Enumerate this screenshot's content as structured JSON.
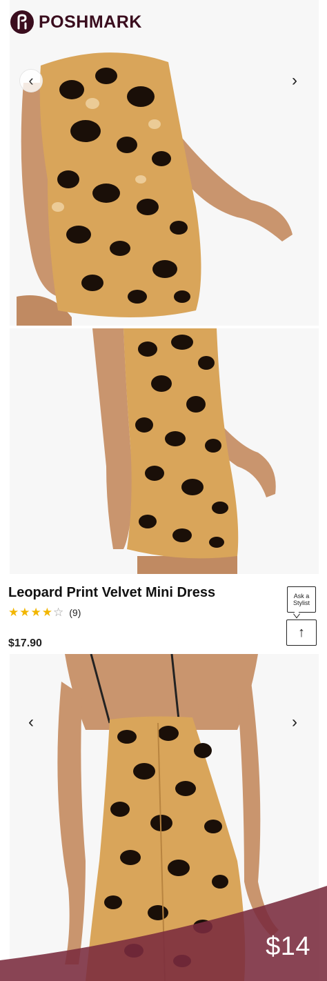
{
  "brand": {
    "name": "POSHMARK",
    "icon": "poshmark-logo-icon",
    "color": "#3a0d1e"
  },
  "gallery_top": {
    "prev_icon": "chevron-left-icon",
    "next_icon": "chevron-right-icon",
    "prev_glyph": "‹",
    "next_glyph": "›"
  },
  "product": {
    "title": "Leopard Print Velvet Mini Dress",
    "rating": 4,
    "rating_max": 5,
    "reviews": "(9)",
    "price": "$17.90"
  },
  "actions": {
    "ask_line1": "Ask a",
    "ask_line2": "Stylist",
    "share_glyph": "↑",
    "share_icon": "share-arrow-icon"
  },
  "gallery_bottom": {
    "prev_glyph": "‹",
    "next_glyph": "›"
  },
  "listing_price": "$14",
  "colors": {
    "price_tag": "#7a2b3d",
    "star": "#f2b600",
    "leopard_base": "#e6c28a",
    "leopard_spot": "#1a0f08"
  }
}
